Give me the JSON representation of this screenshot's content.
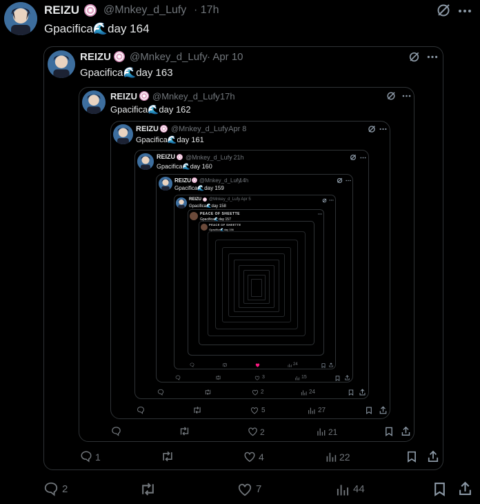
{
  "colors": {
    "background": "#000000",
    "text": "#e7e9ea",
    "muted": "#71767b",
    "border": "#2f3336",
    "like_active": "#f91880"
  },
  "post": {
    "name": "REIZU",
    "handle": "@Mnkey_d_Lufy",
    "time": "· 17h",
    "text": "Gpacifica🌊day 164",
    "replies": "2",
    "reposts": "",
    "likes": "7",
    "views": "44"
  },
  "q1": {
    "name": "REIZU",
    "handle": "@Mnkey_d_Lufy",
    "time": "· Apr 10",
    "text": "Gpacifica🌊day 163",
    "replies": "1",
    "likes": "4",
    "views": "22"
  },
  "q2": {
    "name": "REIZU",
    "handle": "@Mnkey_d_Lufy",
    "time": "· 17h",
    "text": "Gpacifica🌊day 162",
    "likes": "2",
    "views": "21"
  },
  "q3": {
    "name": "REIZU",
    "handle": "@Mnkey_d_Lufy",
    "time": "· Apr 8",
    "text": "Gpacifica🌊day 161",
    "likes": "5",
    "views": "27"
  },
  "q4": {
    "name": "REIZU",
    "handle": "@Mnkey_d_Lufy",
    "time": "· 21h",
    "text": "Gpacifica🌊day 160",
    "likes": "2",
    "views": "24"
  },
  "q5": {
    "name": "REIZU",
    "handle": "@Mnkey_d_Lufy",
    "time": "· 14h",
    "text": "Gpacifica🌊day 159",
    "likes": "3",
    "views": "15"
  },
  "q6": {
    "name": "REIZU",
    "handle": "@Mnkey_d_Lufy",
    "time": "· Apr 5",
    "text": "Gpacifica🌊day 158",
    "likes": "",
    "views": "24"
  },
  "q7": {
    "name": "PEACE OF SHEETTE",
    "text": "Gpacifica🌊day 157"
  },
  "q8": {
    "name": "PEACE OF SHEETTE",
    "text": "Gpacifica🌊day 156"
  },
  "icons": [
    "reply-icon",
    "repost-icon",
    "like-icon",
    "views-icon",
    "bookmark-icon",
    "share-icon",
    "grok-icon",
    "more-icon"
  ]
}
